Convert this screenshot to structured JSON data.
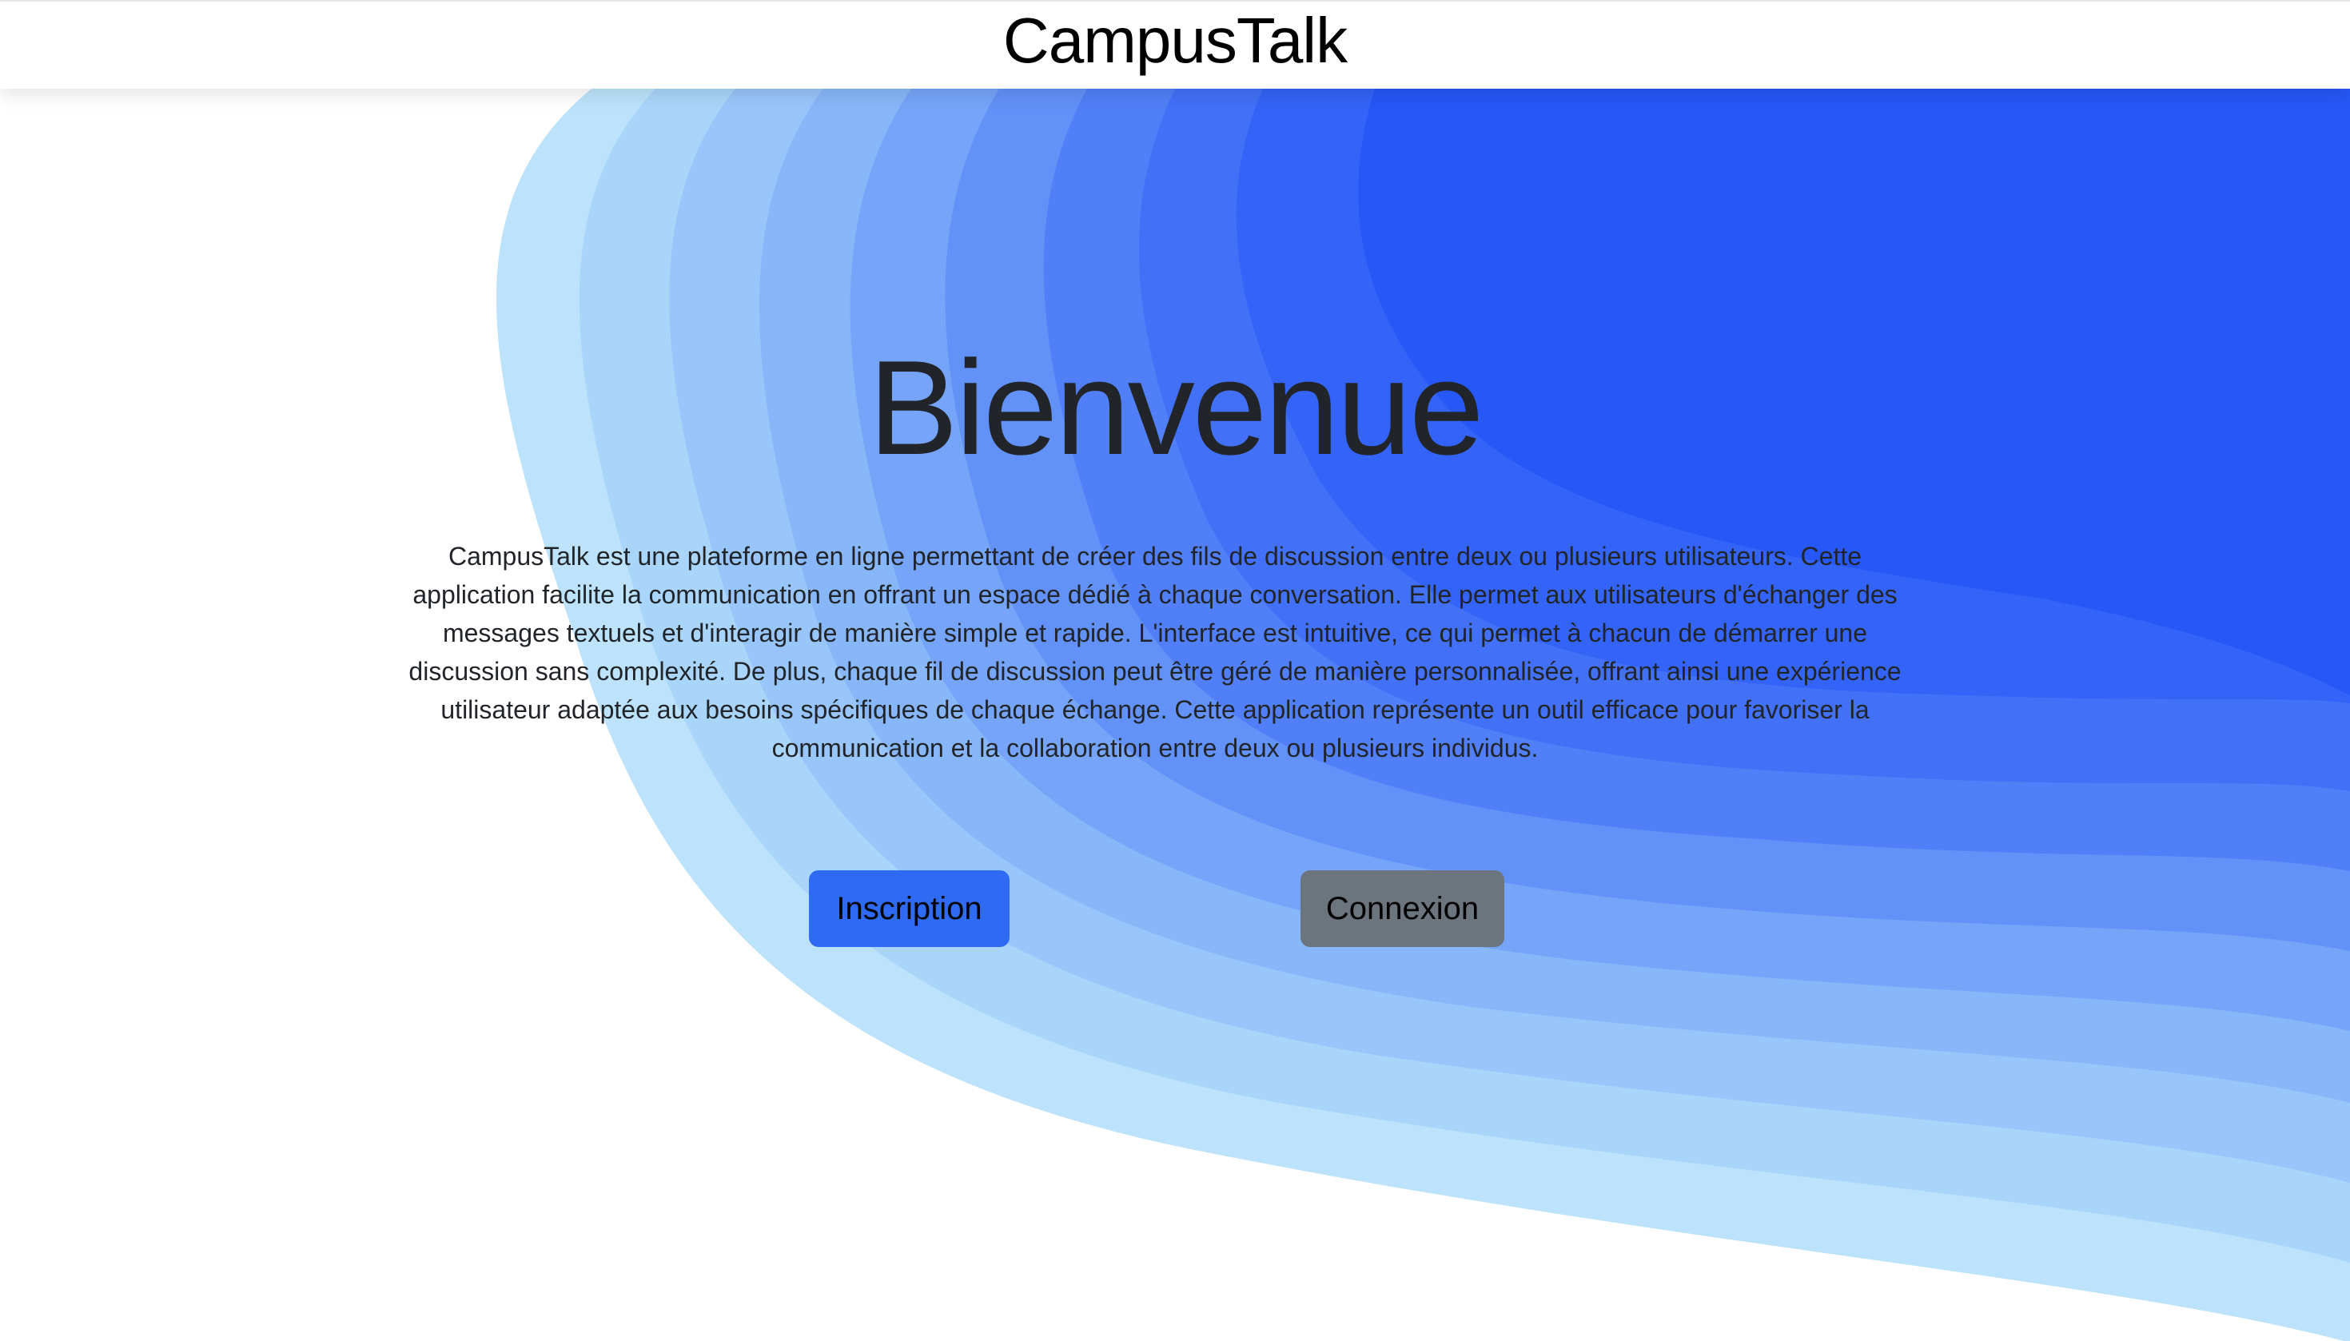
{
  "header": {
    "brand": "CampusTalk"
  },
  "hero": {
    "title": "Bienvenue",
    "description": "CampusTalk est une plateforme en ligne permettant de créer des fils de discussion entre deux ou plusieurs utilisateurs. Cette application facilite la communication en offrant un espace dédié à chaque conversation. Elle permet aux utilisateurs d'échanger des messages textuels et d'interagir de manière simple et rapide. L'interface est intuitive, ce qui permet à chacun de démarrer une discussion sans complexité. De plus, chaque fil de discussion peut être géré de manière personnalisée, offrant ainsi une expérience utilisateur adaptée aux besoins spécifiques de chaque échange. Cette application représente un outil efficace pour favoriser la communication et la collaboration entre deux ou plusieurs individus."
  },
  "actions": {
    "signup_label": "Inscription",
    "login_label": "Connexion"
  },
  "colors": {
    "primary_button": "#2f6bf2",
    "secondary_button": "#6c757d",
    "wave_dark": "#2657f7",
    "wave_light": "#bce3fb"
  }
}
